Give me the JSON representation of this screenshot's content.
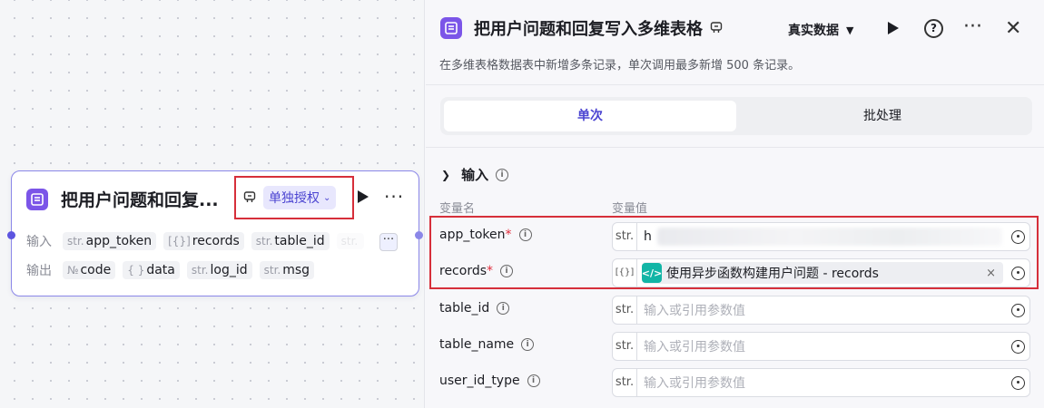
{
  "node": {
    "title": "把用户问题和回复...",
    "auth_label": "单独授权",
    "input_label": "输入",
    "output_label": "输出",
    "inputs": [
      {
        "type": "str.",
        "name": "app_token"
      },
      {
        "type": "[{}]",
        "name": "records"
      },
      {
        "type": "str.",
        "name": "table_id"
      },
      {
        "type": "str.",
        "name": ""
      }
    ],
    "outputs": [
      {
        "type": "№",
        "name": "code"
      },
      {
        "type": "{ }",
        "name": "data"
      },
      {
        "type": "str.",
        "name": "log_id"
      },
      {
        "type": "str.",
        "name": "msg"
      }
    ],
    "more_inputs": "···"
  },
  "panel": {
    "title": "把用户问题和回复写入多维表格",
    "data_mode": "真实数据",
    "description": "在多维表格数据表中新增多条记录，单次调用最多新增 500 条记录。",
    "tabs": [
      {
        "label": "单次",
        "active": true
      },
      {
        "label": "批处理",
        "active": false
      }
    ],
    "section_title": "输入",
    "col_name": "变量名",
    "col_value": "变量值",
    "rows": [
      {
        "name": "app_token",
        "required": "*",
        "type": "str.",
        "value": "h",
        "kind": "blurred"
      },
      {
        "name": "records",
        "required": "*",
        "type": "[{}]",
        "value": "使用异步函数构建用户问题 - records",
        "kind": "ref"
      },
      {
        "name": "table_id",
        "required": "",
        "type": "str.",
        "value": "输入或引用参数值",
        "kind": "placeholder"
      },
      {
        "name": "table_name",
        "required": "",
        "type": "str.",
        "value": "输入或引用参数值",
        "kind": "placeholder"
      },
      {
        "name": "user_id_type",
        "required": "",
        "type": "str.",
        "value": "输入或引用参数值",
        "kind": "placeholder"
      }
    ]
  },
  "colors": {
    "accent": "#4b44d1",
    "app_icon": "#7b55e8",
    "highlight": "#d62f3a",
    "ref_icon": "#12b5a6"
  }
}
